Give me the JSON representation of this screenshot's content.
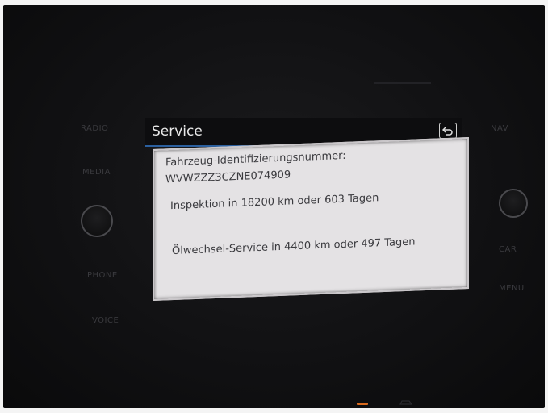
{
  "hardware_buttons": {
    "radio": "RADIO",
    "media": "MEDIA",
    "phone": "PHONE",
    "voice": "VOICE",
    "nav": "NAV",
    "car": "CAR",
    "menu": "MENU"
  },
  "header": {
    "title": "Service",
    "back_icon": "back-arrow-icon"
  },
  "service_panel": {
    "vin_label": "Fahrzeug-Identifizierungsnummer:",
    "vin_value": "WVWZZZ3CZNE074909",
    "inspection": "Inspektion in 18200 km oder 603 Tagen",
    "oil_service": "Ölwechsel-Service in 4400 km oder 497 Tagen"
  },
  "colors": {
    "header_underline": "#2b5f9e",
    "panel_bg": "#e4e2e4",
    "indicator": "#d96a1e"
  }
}
